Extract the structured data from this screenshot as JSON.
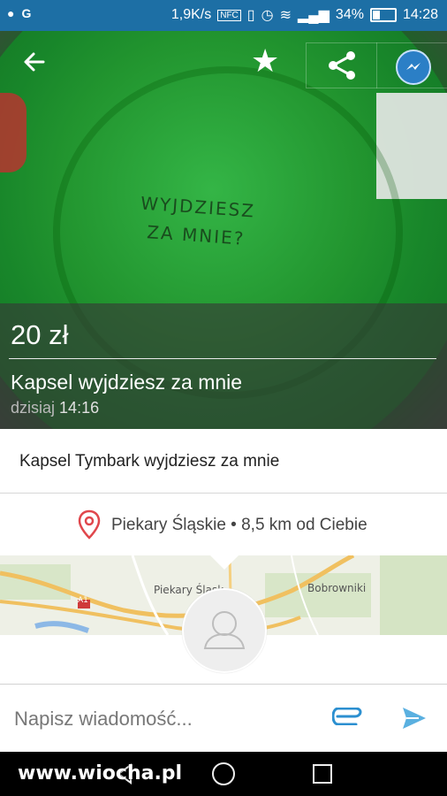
{
  "status_bar": {
    "net_speed": "1,9K/s",
    "nfc": "NFC",
    "battery": "34%",
    "time": "14:28"
  },
  "listing": {
    "photo_caption": [
      "WYJDZIESZ",
      "ZA MNIE?"
    ],
    "price": "20 zł",
    "title": "Kapsel wyjdziesz za mnie",
    "date_prefix": "dzisiaj",
    "date_time": "14:16",
    "description": "Kapsel Tymbark wyjdziesz za mnie",
    "location": "Piekary Śląskie • 8,5 km od Ciebie"
  },
  "map": {
    "labels": [
      "Piekary Śląsk",
      "Bobrowniki",
      "A1"
    ]
  },
  "composer": {
    "placeholder": "Napisz wiadomość..."
  },
  "watermark": "www.wiocha.pl",
  "colors": {
    "status_bar": "#1d6fa5",
    "accent_blue": "#2b8fd0",
    "pin_red": "#e0474c"
  }
}
